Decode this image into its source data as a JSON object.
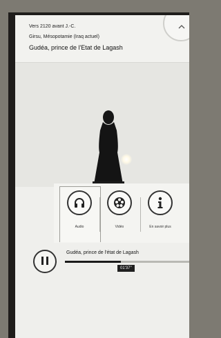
{
  "header": {
    "date": "Vers 2120 avant J.-C.",
    "place": "Girsu, Mésopotamie (Iraq actuel)",
    "title": "Gudéa, prince de l'Etat de Lagash"
  },
  "actions": [
    {
      "label": "Audio",
      "icon": "headphones-icon"
    },
    {
      "label": "Vidéo",
      "icon": "video-reel-icon"
    },
    {
      "label": "En savoir plus",
      "icon": "info-icon"
    }
  ],
  "player": {
    "track_title": "Gudéa, prince de l'état de Lagash",
    "time": "01'37''",
    "progress": 0.45,
    "state_icon": "pause-icon"
  },
  "colors": {
    "screen_bg": "#efefec",
    "accent": "#1a1a1a"
  }
}
